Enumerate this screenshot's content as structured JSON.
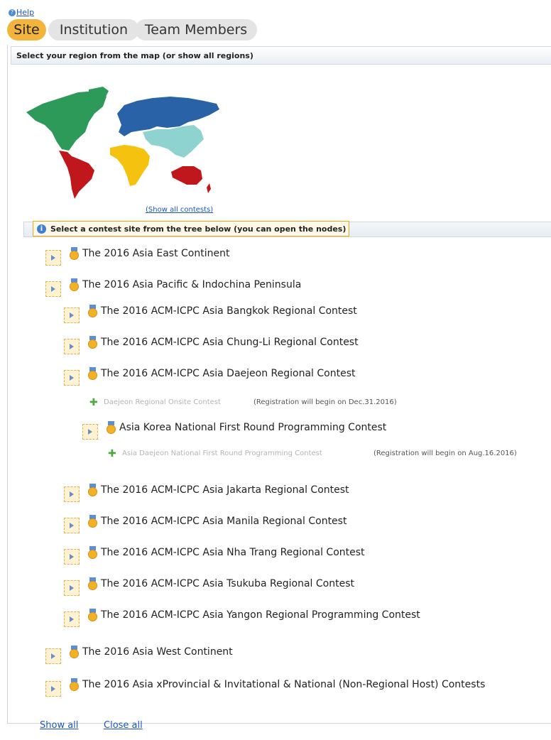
{
  "help": {
    "label": "Help"
  },
  "tabs": [
    {
      "label": "Site",
      "active": true
    },
    {
      "label": "Institution",
      "active": false
    },
    {
      "label": "Team Members",
      "active": false
    }
  ],
  "region_bar": {
    "text": "Select your region from the map (or show all regions)"
  },
  "map": {
    "link": "(Show all contests)"
  },
  "tree_header": {
    "message": "Select a contest site from the tree below (you can open the nodes)"
  },
  "tree": {
    "n1": "The 2016 Asia East Continent",
    "n2": "The 2016 Asia Pacific & Indochina Peninsula",
    "n2_1": "The 2016 ACM-ICPC Asia Bangkok Regional Contest",
    "n2_2": "The 2016 ACM-ICPC Asia Chung-Li Regional Contest",
    "n2_3": "The 2016 ACM-ICPC Asia Daejeon Regional Contest",
    "n2_3_leaf": {
      "name": "Daejeon Regional Onsite Contest",
      "note": "(Registration will begin on Dec.31.2016)"
    },
    "n2_3_1": "Asia Korea National First Round Programming Contest",
    "n2_3_1_leaf": {
      "name": "Asia Daejeon National First Round Programming Contest",
      "note": "(Registration will begin on Aug.16.2016)"
    },
    "n2_4": "The 2016 ACM-ICPC Asia Jakarta Regional Contest",
    "n2_5": "The 2016 ACM-ICPC Asia Manila Regional Contest",
    "n2_6": "The 2016 ACM-ICPC Asia Nha Trang Regional Contest",
    "n2_7": "The 2016 ACM-ICPC Asia Tsukuba Regional Contest",
    "n2_8": "The 2016 ACM-ICPC Asia Yangon Regional Programming Contest",
    "n3": "The 2016 Asia West Continent",
    "n4": "The 2016 Asia xProvincial & Invitational & National (Non-Regional Host) Contests"
  },
  "footer": {
    "show_all": "Show all",
    "close_all": "Close all"
  },
  "colors": {
    "active_tab": "#f3b43d",
    "link": "#1a56c6",
    "region_americas_north": "#2e9a5a",
    "region_americas_south": "#c0171c",
    "region_europe_asia": "#2a62a8",
    "region_africa": "#f5c20f",
    "region_asia_south": "#8fd3d1",
    "region_oceania": "#c0171c"
  },
  "icons": {
    "tree_node": "medal-icon",
    "tree_leaf": "puzzle-icon",
    "info": "info-icon",
    "expand": "expand-triangle-icon"
  }
}
